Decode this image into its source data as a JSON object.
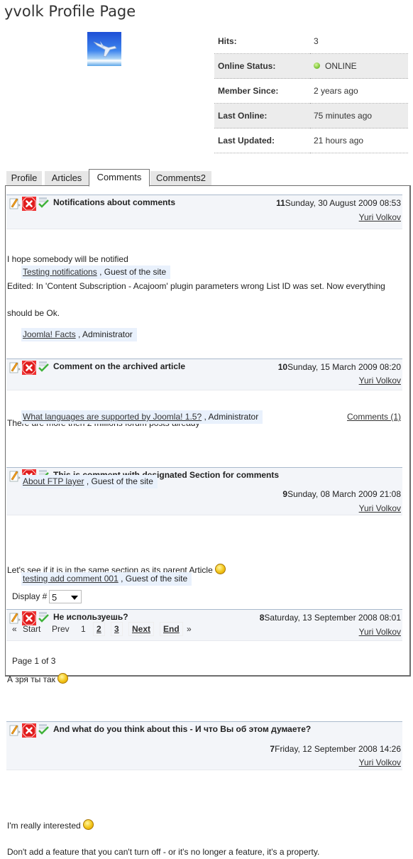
{
  "page": {
    "title": "yvolk Profile Page"
  },
  "profile": {
    "avatar_alt": "airplane-avatar",
    "info": [
      {
        "label": "Hits:",
        "value": "3"
      },
      {
        "label": "Online Status:",
        "value": "ONLINE",
        "status_color": "#6ab02a"
      },
      {
        "label": "Member Since:",
        "value": "2 years ago"
      },
      {
        "label": "Last Online:",
        "value": "75 minutes ago"
      },
      {
        "label": "Last Updated:",
        "value": "21 hours ago"
      }
    ]
  },
  "tabs": [
    {
      "label": "Profile",
      "active": false
    },
    {
      "label": "Articles",
      "active": false
    },
    {
      "label": "Comments",
      "active": true
    },
    {
      "label": "Comments2",
      "active": false
    }
  ],
  "comments": [
    {
      "title": "Notifications about comments",
      "number": "11",
      "date": "Sunday, 30 August 2009 08:53",
      "author": "Yuri Volkov",
      "lines": [
        "I hope somebody will be notified",
        "Edited: In 'Content Subscription - Acajoom' plugin parameters wrong List ID was set. Now everything",
        "should be Ok."
      ],
      "article": "Testing notifications",
      "article_author": ", Guest of the site"
    },
    {
      "title": "Comment on the archived article",
      "number": "10",
      "date": "Sunday, 15 March 2009 08:20",
      "author": "Yuri Volkov",
      "lines": [
        "There are more then 2 millions forum posts already"
      ],
      "article": "Joomla! Facts",
      "article_author": ", Administrator"
    },
    {
      "title": "This is comment with designated Section for comments",
      "number": "9",
      "date": "Sunday, 08 March 2009 21:08",
      "author": "Yuri Volkov",
      "lines": [
        "Let's see if it is in the same section as its parent Article"
      ],
      "smiley": "rolleyes",
      "article": "What languages are supported by Joomla! 1.5?",
      "article_author": ", Administrator",
      "comments_link": "Comments (1)"
    },
    {
      "title": "Не используешь?",
      "number": "8",
      "date": "Saturday, 13 September 2008 08:01",
      "author": "Yuri Volkov",
      "lines": [
        "А зря ты так"
      ],
      "smiley": "wink",
      "article": "About FTP layer",
      "article_author": ", Guest of the site"
    },
    {
      "title": "And what do you think about this - И что Вы об этом думаете?",
      "number": "7",
      "date": "Friday, 12 September 2008 14:26",
      "author": "Yuri Volkov",
      "lines": [
        "I'm really interested",
        "Don't add a feature that you can't turn off - or it's no longer a feature, it's a property."
      ],
      "smiley": "wink",
      "article": "testing add comment 001",
      "article_author": ", Guest of the site"
    }
  ],
  "display": {
    "label": "Display #",
    "value": "5"
  },
  "pagination": {
    "start_prefix": "«",
    "start": "Start",
    "prev": "Prev",
    "current": "1",
    "pages": [
      "2",
      "3"
    ],
    "next": "Next",
    "end": "End",
    "end_suffix": "»",
    "summary": "Page 1 of 3"
  }
}
